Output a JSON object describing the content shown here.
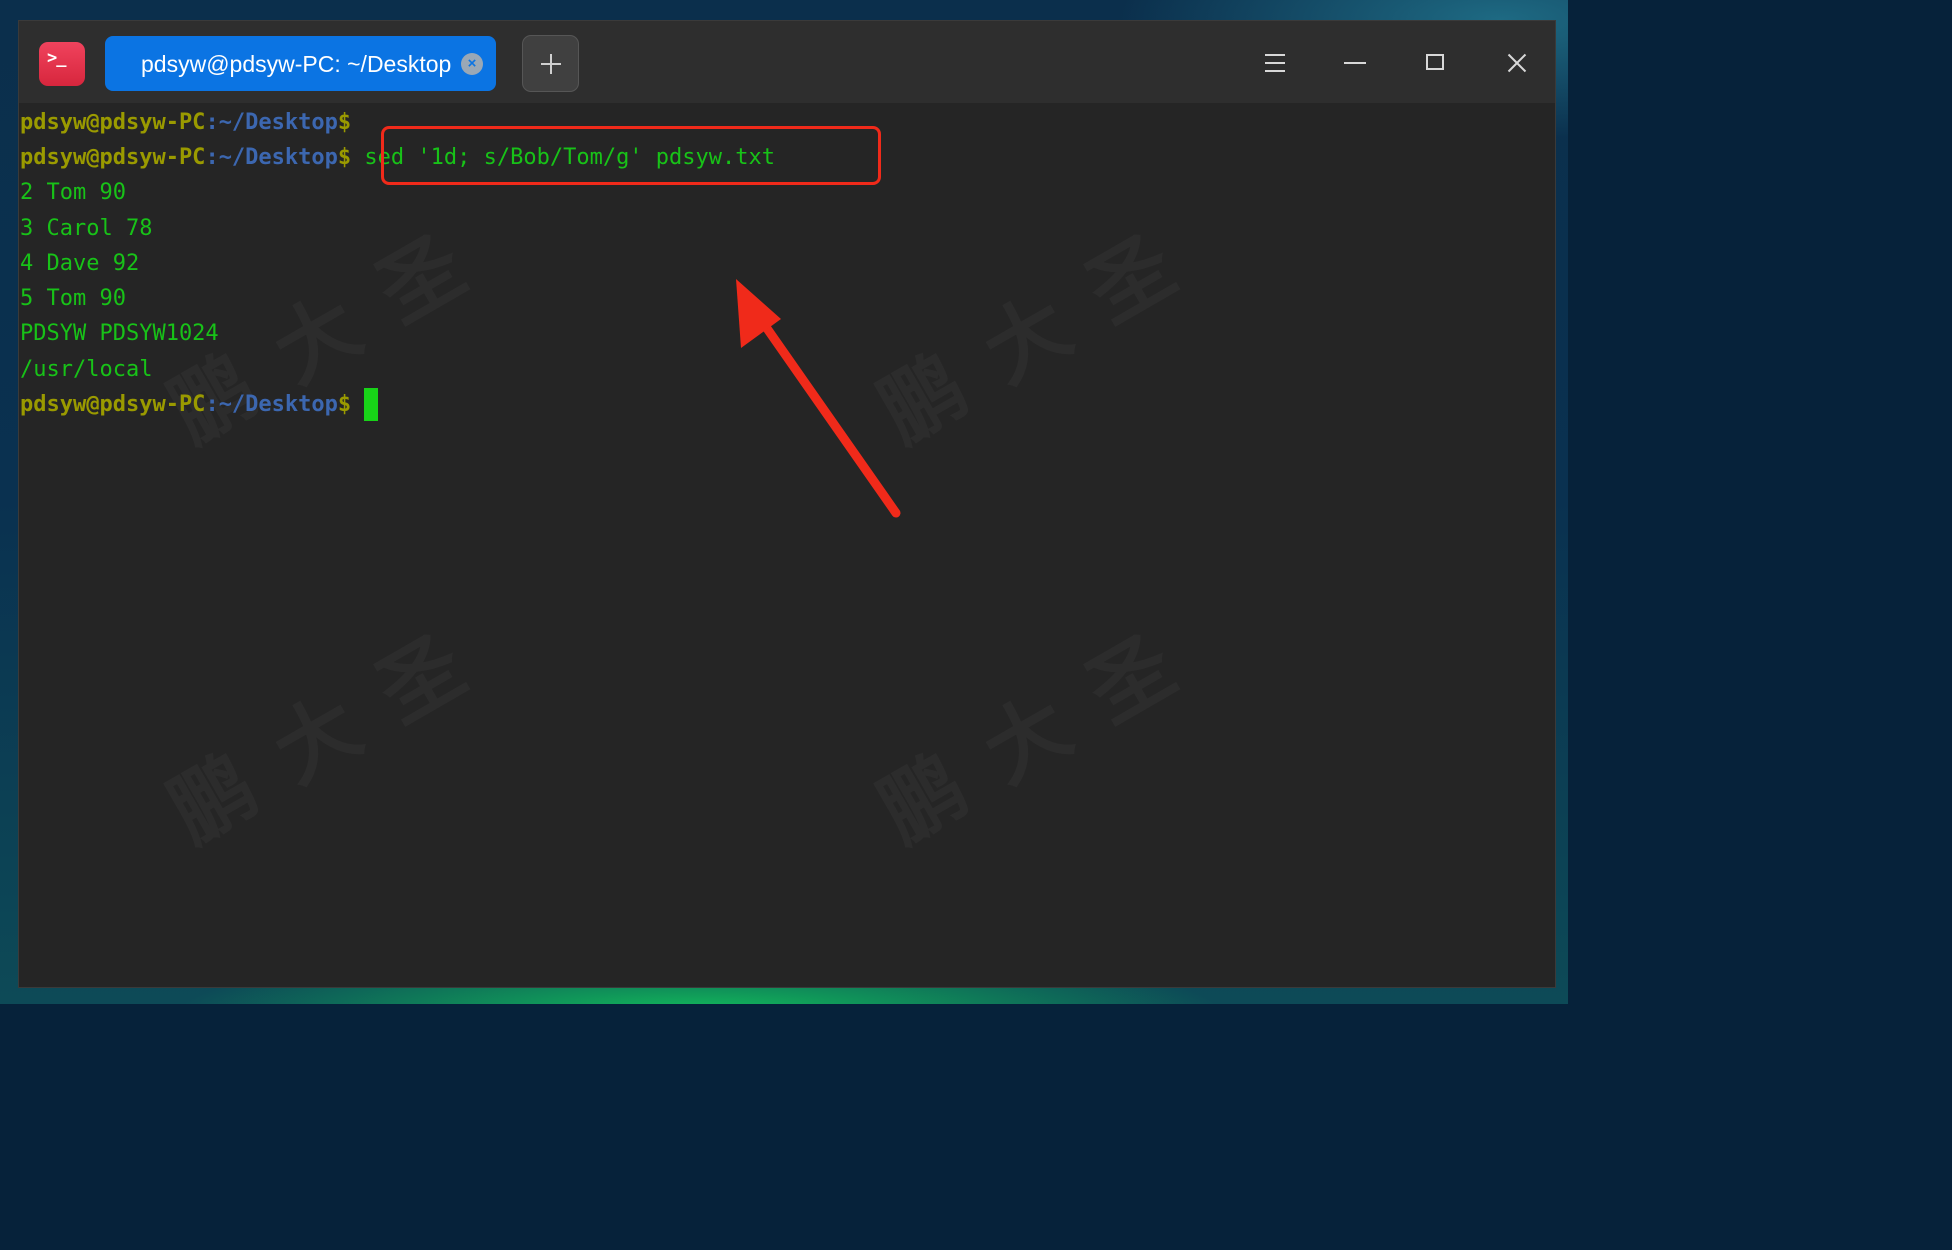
{
  "window": {
    "app_icon_glyph": ">_",
    "tab": {
      "label": "pdsyw@pdsyw-PC: ~/Desktop",
      "close_glyph": "×"
    },
    "controls": [
      "menu-icon",
      "minimize-icon",
      "maximize-icon",
      "close-icon"
    ]
  },
  "prompt": {
    "user": "pdsyw@pdsyw-PC",
    "colon": ":",
    "path": "~/Desktop",
    "dollar": "$"
  },
  "command": "sed '1d; s/Bob/Tom/g' pdsyw.txt",
  "output": [
    "2 Tom 90",
    "3 Carol 78",
    "4 Dave 92",
    "5 Tom 90",
    "PDSYW PDSYW1024",
    "/usr/local"
  ],
  "watermark": "鹏大圣",
  "colors": {
    "annotation": "#f02a1a",
    "tab_active": "#0b74e3",
    "terminal_text": "#18c218"
  }
}
